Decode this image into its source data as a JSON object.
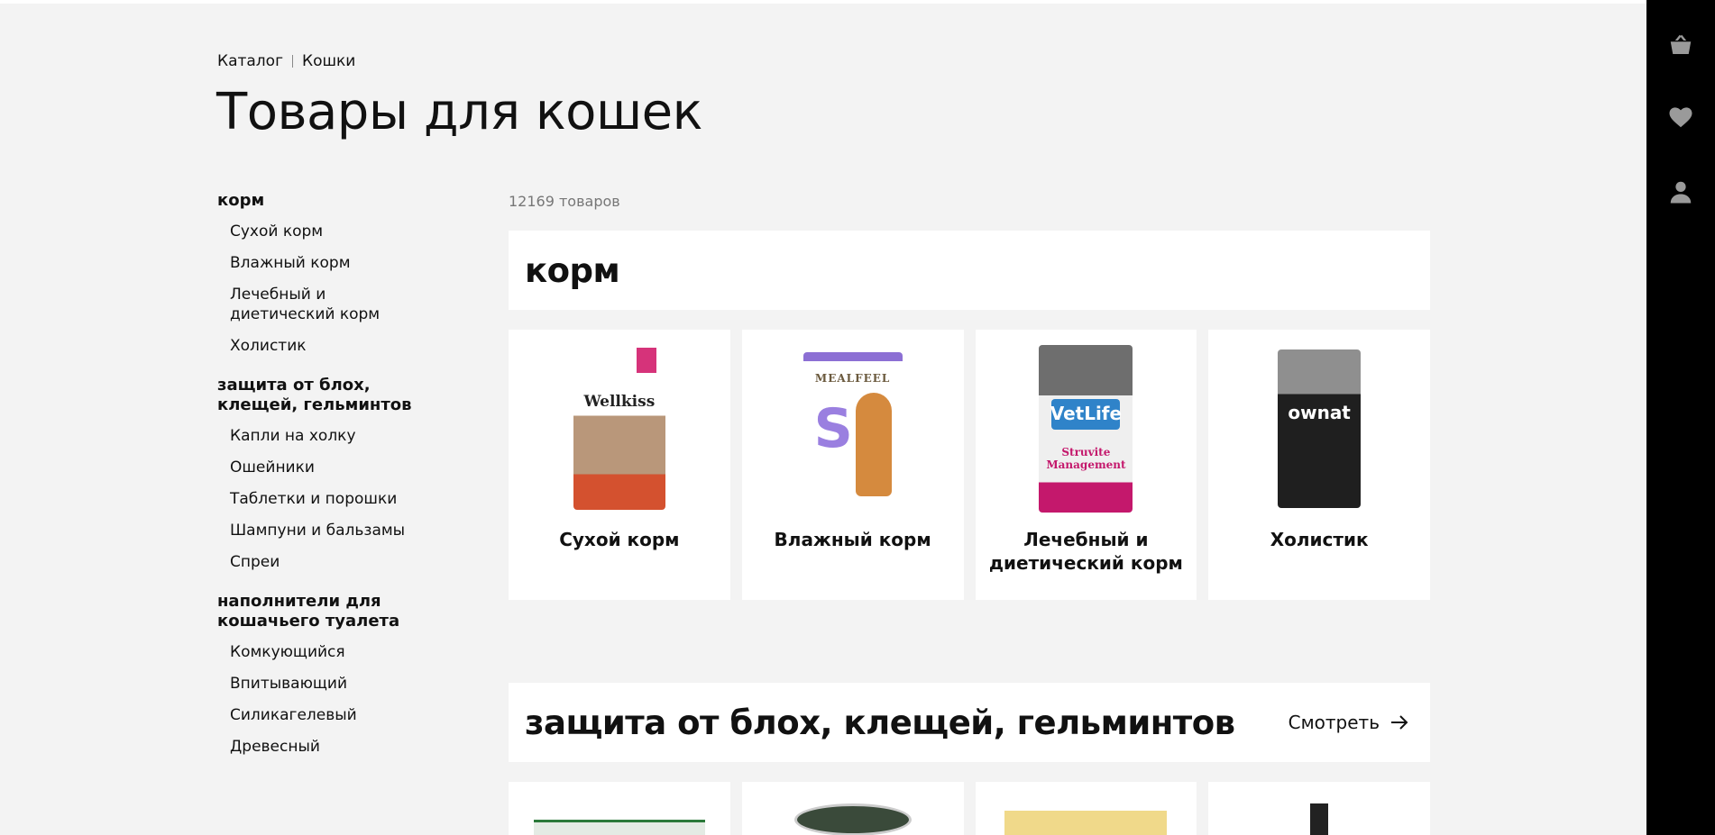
{
  "breadcrumb": [
    "Каталог",
    "Кошки"
  ],
  "page_title": "Товары для кошек",
  "sidebar": {
    "groups": [
      {
        "heading": "корм",
        "items": [
          "Сухой корм",
          "Влажный корм",
          "Лечебный и диетический корм",
          "Холистик"
        ]
      },
      {
        "heading": "защита от блох, клещей, гельминтов",
        "items": [
          "Капли на холку",
          "Ошейники",
          "Таблетки и порошки",
          "Шампуни и бальзамы",
          "Спреи"
        ]
      },
      {
        "heading": "наполнители для кошачьего туалета",
        "items": [
          "Комкующийся",
          "Впитывающий",
          "Силикагелевый",
          "Древесный"
        ]
      }
    ]
  },
  "main": {
    "count_text": "12169 товаров",
    "sections": [
      {
        "title": "корм",
        "cards": [
          {
            "label": "Сухой корм",
            "brand": "Wellkiss"
          },
          {
            "label": "Влажный корм",
            "brand": "MEALFEEL"
          },
          {
            "label": "Лечебный и диетический корм",
            "brand": "VetLife",
            "sub": "Struvite Management"
          },
          {
            "label": "Холистик",
            "brand": "ownat"
          }
        ]
      },
      {
        "title": "защита от блох, клещей, гельминтов",
        "see_all": "Смотреть"
      }
    ]
  },
  "rail": {
    "icons": [
      "basket-icon",
      "heart-icon",
      "user-icon"
    ]
  },
  "colors": {
    "background": "#f3f3f3",
    "rail": "#000000",
    "card": "#ffffff",
    "rail_icon": "#9a9a9a"
  }
}
